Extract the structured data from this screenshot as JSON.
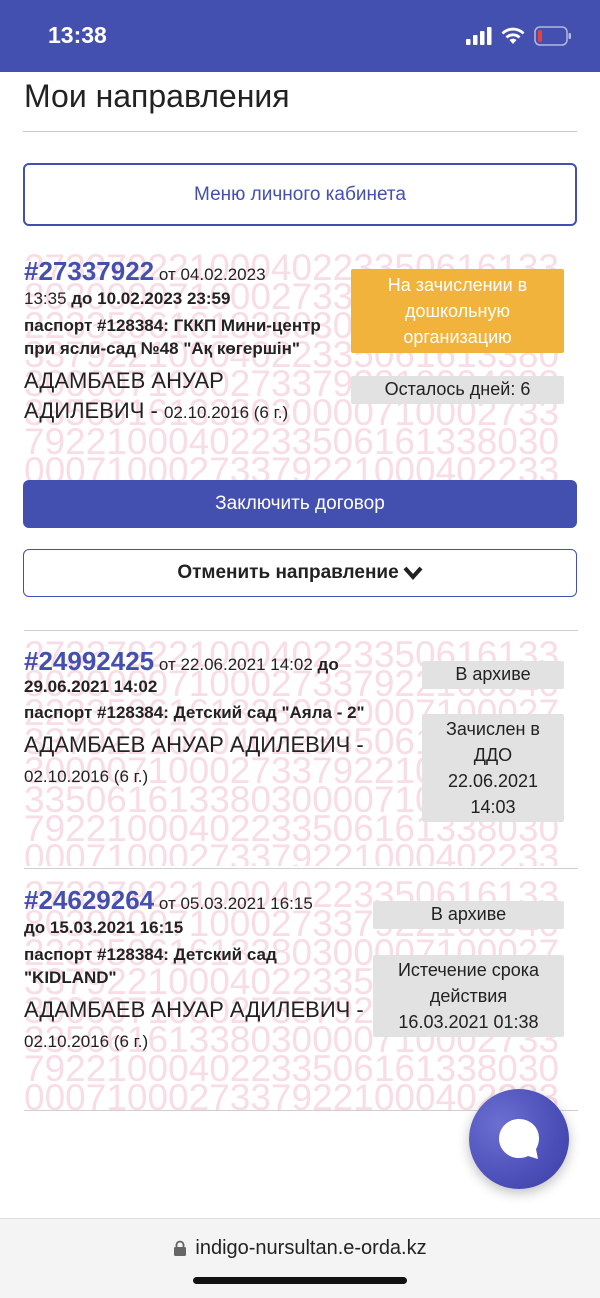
{
  "status": {
    "time": "13:38"
  },
  "page_title": "Мои направления",
  "menu_button": "Меню личного кабинета",
  "watermark_text": "273379221000402233506161338030000710002733792210004022335061613380300007100027337922100040223350616133803000071000273379221000402233506161338030000710002733792210004022335061613380300007100027337922100040223350616133803000071000",
  "cards": [
    {
      "number": "#27337922",
      "from_label": " от 04.02.2023",
      "time": "13:35",
      "until": " до 10.02.2023 23:59",
      "org": "паспорт #128384: ГККП Мини-центр при ясли-сад №48 \"Ақ көгершін\"",
      "child_name": "АДАМБАЕВ АНУАР АДИЛЕВИЧ",
      "child_sep": " - ",
      "dob": "02.10.2016 (6 г.)",
      "status": "На зачислении в дошкольную организацию",
      "extra_status": "Осталось дней: 6",
      "sign_button": "Заключить договор",
      "cancel_button": "Отменить направление"
    },
    {
      "number": "#24992425",
      "from_label": " от 22.06.2021 14:02",
      "until": " до 29.06.2021 14:02",
      "org": "паспорт #128384: Детский сад \"Аяла - 2\"",
      "child_name": "АДАМБАЕВ АНУАР АДИЛЕВИЧ",
      "child_sep": " - ",
      "dob": "02.10.2016 (6 г.)",
      "status": "В архиве",
      "extra_status": "Зачислен в ДДО 22.06.2021 14:03"
    },
    {
      "number": "#24629264",
      "from_label": " от 05.03.2021 16:15",
      "until": "до 15.03.2021 16:15",
      "org": "паспорт #128384: Детский сад \"KIDLAND\"",
      "child_name": "АДАМБАЕВ АНУАР АДИЛЕВИЧ",
      "child_sep": " - ",
      "dob": "02.10.2016 (6 г.)",
      "status": "В архиве",
      "extra_status": "Истечение срока действия 16.03.2021 01:38"
    }
  ],
  "browser": {
    "url": "indigo-nursultan.e-orda.kz"
  },
  "colors": {
    "primary": "#4350b0",
    "warning": "#f2b33d",
    "badge_bg": "#e2e2e2",
    "watermark": "#f8dde5"
  },
  "icons": [
    "signal-icon",
    "wifi-icon",
    "battery-icon",
    "chevron-down-icon",
    "chat-icon",
    "lock-icon"
  ]
}
